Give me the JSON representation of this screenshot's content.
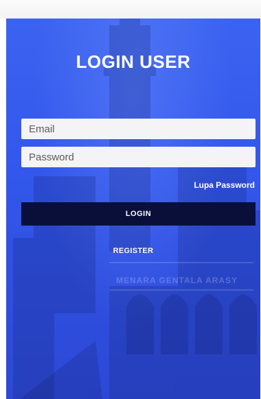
{
  "screen": {
    "title": "LOGIN USER",
    "background_color": "#3357ec",
    "button_color": "#0a0f3a"
  },
  "form": {
    "email_placeholder": "Email",
    "password_placeholder": "Password",
    "forgot_password_label": "Lupa Password",
    "login_label": "LOGIN",
    "register_label": "REGISTER"
  },
  "background": {
    "sign_text": "MENARA GENTALA ARASY"
  }
}
